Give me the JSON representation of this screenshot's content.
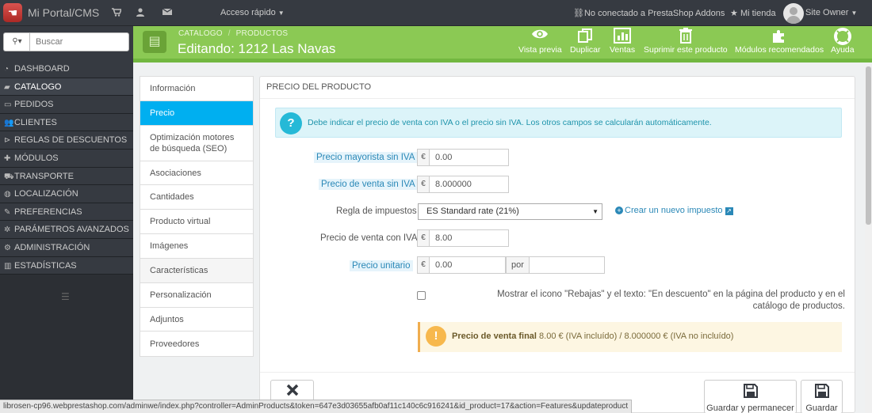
{
  "topbar": {
    "brand": "Mi Portal/CMS",
    "quick_access": "Acceso rápido",
    "addons_status": "No conectado a PrestaShop Addons",
    "my_shop": "Mi tienda",
    "owner": "Site Owner",
    "icons": [
      "cart-icon",
      "user-icon",
      "envelope-icon"
    ]
  },
  "sidebar": {
    "search_placeholder": "Buscar",
    "items": [
      {
        "label": "DASHBOARD",
        "icon": "dashboard-icon"
      },
      {
        "label": "CATALOGO",
        "icon": "book-icon",
        "active": true
      },
      {
        "label": "PEDIDOS",
        "icon": "credit-card-icon"
      },
      {
        "label": "CLIENTES",
        "icon": "users-icon"
      },
      {
        "label": "REGLAS DE DESCUENTOS",
        "icon": "tags-icon"
      },
      {
        "label": "MÓDULOS",
        "icon": "puzzle-icon"
      },
      {
        "label": "TRANSPORTE",
        "icon": "truck-icon"
      },
      {
        "label": "LOCALIZACIÓN",
        "icon": "globe-icon"
      },
      {
        "label": "PREFERENCIAS",
        "icon": "wrench-icon"
      },
      {
        "label": "PARÁMETROS AVANZADOS",
        "icon": "cogs-icon"
      },
      {
        "label": "ADMINISTRACIÓN",
        "icon": "cog-icon"
      },
      {
        "label": "ESTADÍSTICAS",
        "icon": "bar-chart-icon"
      }
    ]
  },
  "toolbar": {
    "breadcrumb": [
      "CATALOGO",
      "PRODUCTOS"
    ],
    "title": "Editando: 1212 Las Navas",
    "buttons": [
      {
        "label": "Vista previa",
        "icon": "eye-icon"
      },
      {
        "label": "Duplicar",
        "icon": "copy-icon"
      },
      {
        "label": "Ventas",
        "icon": "chart-icon"
      },
      {
        "label": "Suprimir este producto",
        "icon": "trash-icon"
      },
      {
        "label": "Módulos recomendados",
        "icon": "puzzle-icon"
      },
      {
        "label": "Ayuda",
        "icon": "lifebuoy-icon"
      }
    ]
  },
  "tabs": [
    "Información",
    "Precio",
    "Optimización motores de búsqueda (SEO)",
    "Asociaciones",
    "Cantidades",
    "Producto virtual",
    "Imágenes",
    "Características",
    "Personalización",
    "Adjuntos",
    "Proveedores"
  ],
  "active_tab": "Precio",
  "panel": {
    "title": "PRECIO DEL PRODUCTO",
    "info": "Debe indicar el precio de venta con IVA o el precio sin IVA. Los otros campos se calcularán automáticamente.",
    "fields": {
      "wholesale_label": "Precio mayorista sin IVA",
      "wholesale_value": "0.00",
      "retail_label": "Precio de venta sin IVA",
      "retail_value": "8.000000",
      "tax_rule_label": "Regla de impuestos",
      "tax_rule_value": "ES Standard rate (21%)",
      "new_tax_link": "Crear un nuevo impuesto",
      "retail_tax_label": "Precio de venta con IVA",
      "retail_tax_value": "8.00",
      "unit_label": "Precio unitario",
      "unit_value": "0.00",
      "unit_per": "por",
      "unit_per_value": "",
      "currency": "€"
    },
    "on_sale_text": "Mostrar el icono \"Rebajas\" y el texto: \"En descuento\" en la página del producto y en el catálogo de productos.",
    "final_price_label": "Precio de venta final",
    "final_price_text": "8.00 € (IVA incluído) / 8.000000 € (IVA no incluído)",
    "footer": {
      "cancel_label": "",
      "save_stay_label": "Guardar y permanecer",
      "save_label": "Guardar"
    }
  },
  "status_url": "librosen-cp96.webprestashop.com/adminwe/index.php?controller=AdminProducts&token=647e3d03655afb0af11c140c6c916241&id_product=17&action=Features&updateproduct"
}
